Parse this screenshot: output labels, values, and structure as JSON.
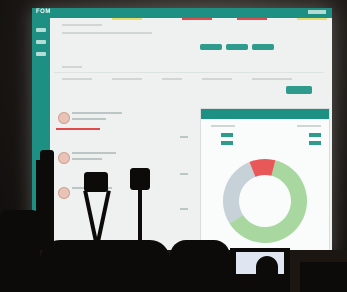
{
  "screen": {
    "logo": "FOM",
    "colors": {
      "primary": "#1e8f83",
      "accent_red": "#e04a4a",
      "accent_green": "#2e9b8c",
      "donut_green": "#a8d8a0",
      "donut_gray": "#c7d1d8",
      "donut_red": "#e85858"
    }
  },
  "donut": {
    "segments": [
      {
        "name": "green",
        "fraction": 0.62
      },
      {
        "name": "gray",
        "fraction": 0.28
      },
      {
        "name": "red",
        "fraction": 0.1
      }
    ]
  }
}
